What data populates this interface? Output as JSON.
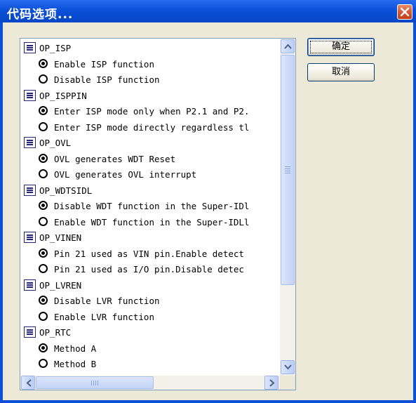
{
  "window": {
    "title": "代码选项..."
  },
  "options": [
    {
      "group": "OP_ISP",
      "items": [
        {
          "label": "Enable ISP function",
          "selected": true
        },
        {
          "label": "Disable ISP function",
          "selected": false
        }
      ]
    },
    {
      "group": "OP_ISPPIN",
      "items": [
        {
          "label": "Enter ISP mode only when P2.1 and P2.",
          "selected": true
        },
        {
          "label": "Enter ISP mode directly regardless tl",
          "selected": false
        }
      ]
    },
    {
      "group": "OP_OVL",
      "items": [
        {
          "label": "OVL generates WDT Reset",
          "selected": true
        },
        {
          "label": "OVL generates OVL interrupt",
          "selected": false
        }
      ]
    },
    {
      "group": "OP_WDTSIDL",
      "items": [
        {
          "label": "Disable WDT function in the Super-IDl",
          "selected": true
        },
        {
          "label": "Enable WDT function in the Super-IDLl",
          "selected": false
        }
      ]
    },
    {
      "group": "OP_VINEN",
      "items": [
        {
          "label": "Pin 21 used as VIN pin.Enable detect",
          "selected": true
        },
        {
          "label": "Pin 21 used as I/O pin.Disable detec",
          "selected": false
        }
      ]
    },
    {
      "group": "OP_LVREN",
      "items": [
        {
          "label": "Disable LVR function",
          "selected": true
        },
        {
          "label": "Enable LVR function",
          "selected": false
        }
      ]
    },
    {
      "group": "OP_RTC",
      "items": [
        {
          "label": "Method A",
          "selected": true
        },
        {
          "label": "Method B",
          "selected": false
        }
      ]
    }
  ],
  "buttons": {
    "ok": "确定",
    "cancel": "取消"
  }
}
